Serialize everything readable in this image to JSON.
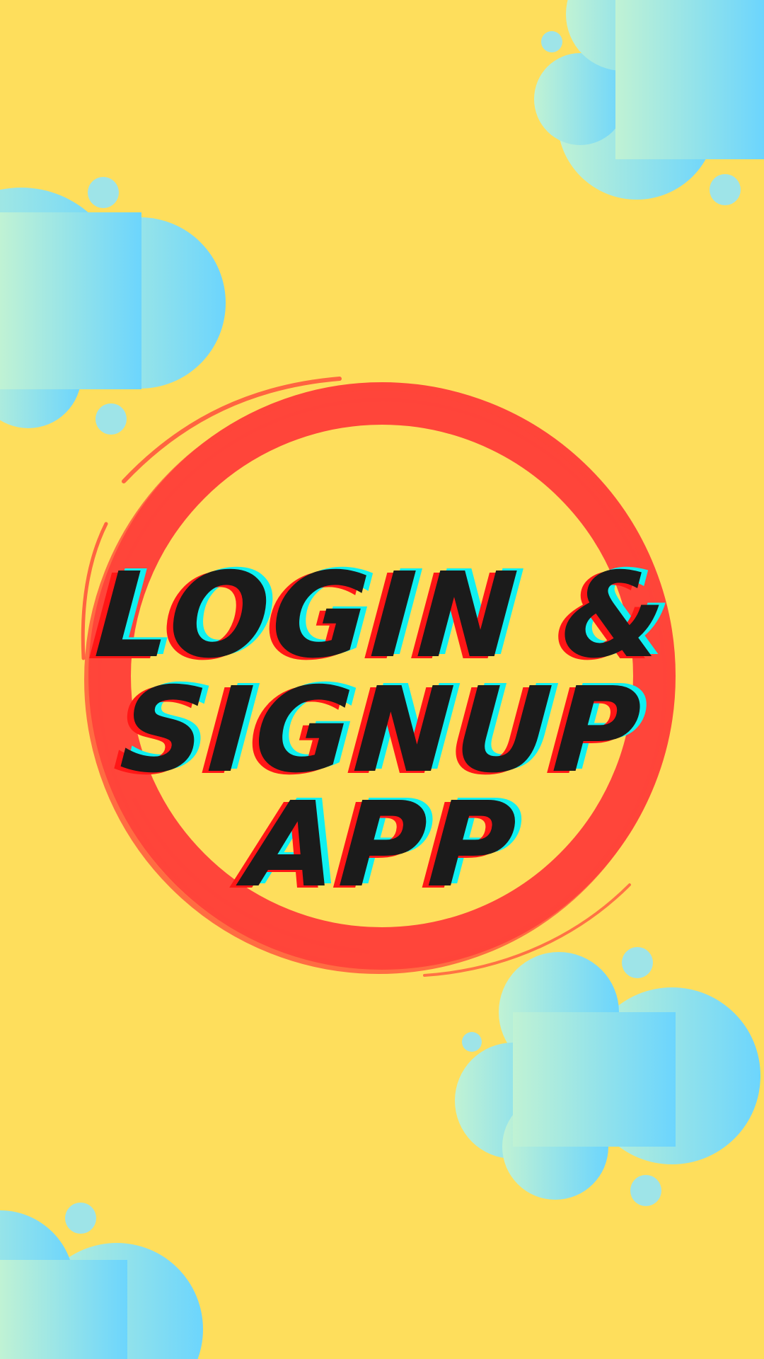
{
  "screen": {
    "background_color": "#FEDE5C"
  },
  "title": {
    "lines": [
      "LOGIN &",
      "SIGNUP",
      "APP"
    ],
    "text_color": "#1B1B1B",
    "shadow_red": "#FF1616",
    "shadow_cyan": "#10F0F0"
  },
  "decor": {
    "ring_color": "#FF453A",
    "cloud_gradient_start": "#C0F2D4",
    "cloud_gradient_end": "#6CD5FD",
    "dot_color": "#9EE4E8",
    "icons": [
      "brush-ring-icon",
      "cloud-icon"
    ]
  }
}
